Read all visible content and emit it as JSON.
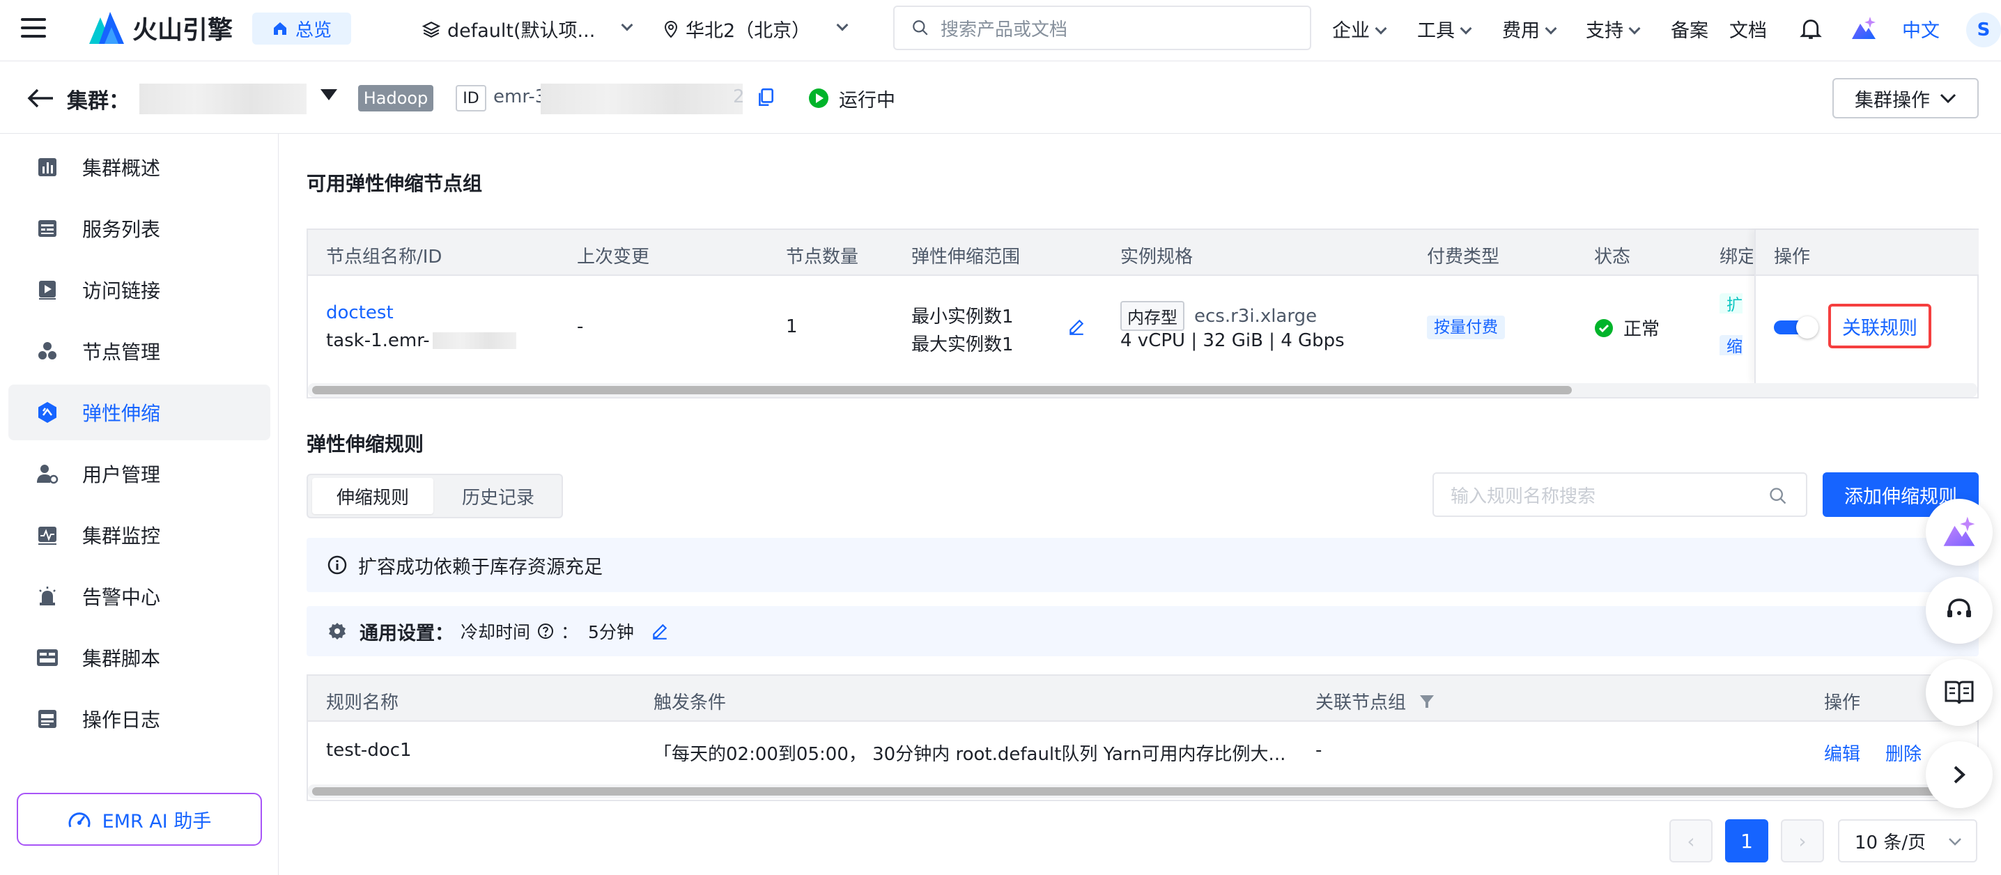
{
  "topnav": {
    "brand": "火山引擎",
    "overview": "总览",
    "project": "default(默认项...",
    "region": "华北2（北京）",
    "search_placeholder": "搜索产品或文档",
    "menus": [
      "企业",
      "工具",
      "费用",
      "支持"
    ],
    "links": [
      "备案",
      "文档"
    ],
    "lang": "中文",
    "avatar": "S"
  },
  "cluster": {
    "label": "集群：",
    "type_tag": "Hadoop",
    "id_tag": "ID",
    "id_prefix": "emr-3",
    "id_suffix": "2",
    "status": "运行中",
    "op_button": "集群操作"
  },
  "sidebar": {
    "items": [
      {
        "label": "集群概述",
        "icon": "bar-chart-icon"
      },
      {
        "label": "服务列表",
        "icon": "list-icon"
      },
      {
        "label": "访问链接",
        "icon": "link-icon"
      },
      {
        "label": "节点管理",
        "icon": "nodes-icon"
      },
      {
        "label": "弹性伸缩",
        "icon": "scaling-icon"
      },
      {
        "label": "用户管理",
        "icon": "user-icon"
      },
      {
        "label": "集群监控",
        "icon": "monitor-icon"
      },
      {
        "label": "告警中心",
        "icon": "alarm-icon"
      },
      {
        "label": "集群脚本",
        "icon": "script-icon"
      },
      {
        "label": "操作日志",
        "icon": "log-icon"
      }
    ],
    "ai_button": "EMR AI 助手"
  },
  "node_groups": {
    "title": "可用弹性伸缩节点组",
    "headers": [
      "节点组名称/ID",
      "上次变更",
      "节点数量",
      "弹性伸缩范围",
      "实例规格",
      "付费类型",
      "状态",
      "绑定",
      "操作"
    ],
    "row": {
      "name": "doctest",
      "id_prefix": "task-1.emr-",
      "last_change": "-",
      "count": "1",
      "min": "最小实例数1",
      "max": "最大实例数1",
      "spec_tag": "内存型",
      "spec_code": "ecs.r3i.xlarge",
      "spec_detail": "4 vCPU | 32 GiB | 4 Gbps",
      "billing": "按量付费",
      "status": "正常",
      "bind_1": "扩容",
      "bind_2": "缩容",
      "action": "关联规则"
    }
  },
  "rules": {
    "title": "弹性伸缩规则",
    "tabs": [
      "伸缩规则",
      "历史记录"
    ],
    "search_placeholder": "输入规则名称搜索",
    "add_button": "添加伸缩规则",
    "notice": "扩容成功依赖于库存资源充足",
    "settings_label": "通用设置：",
    "cooldown_label": "冷却时间",
    "cooldown_colon": "：",
    "cooldown_value": "5分钟",
    "headers": [
      "规则名称",
      "触发条件",
      "关联节点组",
      "操作"
    ],
    "row": {
      "name": "test-doc1",
      "condition": "「每天的02:00到05:00， 30分钟内 root.default队列 Yarn可用内存比例大...",
      "group": "-",
      "edit": "编辑",
      "delete": "删除"
    }
  },
  "pagination": {
    "prev": "‹",
    "page": "1",
    "next": "›",
    "page_size": "10 条/页"
  },
  "colors": {
    "accent": "#1664ff",
    "success": "#00b42a",
    "highlight": "#f53f3f"
  }
}
